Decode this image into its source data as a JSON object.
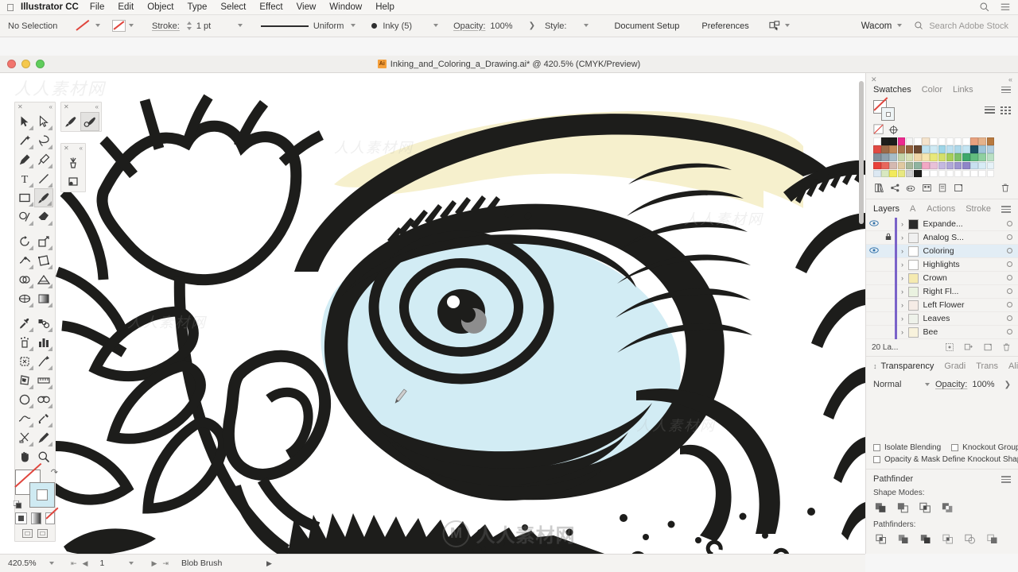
{
  "menubar": {
    "apple": "",
    "app_name": "Illustrator CC",
    "items": [
      "File",
      "Edit",
      "Object",
      "Type",
      "Select",
      "Effect",
      "View",
      "Window",
      "Help"
    ],
    "search_icon": "search-icon",
    "list_icon": "list-icon"
  },
  "optionsbar": {
    "selection_status": "No Selection",
    "stroke_label": "Stroke:",
    "stroke_weight": "1 pt",
    "profile_label": "Uniform",
    "brush_label": "Inky (5)",
    "opacity_label": "Opacity:",
    "opacity_value": "100%",
    "style_label": "Style:",
    "document_setup": "Document Setup",
    "preferences": "Preferences",
    "workspace_user": "Wacom",
    "search_placeholder": "Search Adobe Stock",
    "arrange_icon": "arrange-documents-icon"
  },
  "tabbar": {
    "doc_title": "Inking_and_Coloring_a_Drawing.ai* @ 420.5% (CMYK/Preview)",
    "badge": "Ai"
  },
  "toolbar": {
    "tools": [
      {
        "name": "selection-tool",
        "label": "Selection"
      },
      {
        "name": "direct-selection-tool",
        "label": "Direct Selection"
      },
      {
        "name": "magic-wand-tool",
        "label": "Magic Wand"
      },
      {
        "name": "lasso-tool",
        "label": "Lasso"
      },
      {
        "name": "pen-tool",
        "label": "Pen"
      },
      {
        "name": "curvature-tool",
        "label": "Curvature"
      },
      {
        "name": "type-tool",
        "label": "Type"
      },
      {
        "name": "line-segment-tool",
        "label": "Line Segment"
      },
      {
        "name": "rectangle-tool",
        "label": "Rectangle"
      },
      {
        "name": "paintbrush-tool",
        "label": "Paintbrush"
      },
      {
        "name": "shaper-tool",
        "label": "Shaper"
      },
      {
        "name": "eraser-tool",
        "label": "Eraser"
      },
      {
        "name": "rotate-tool",
        "label": "Rotate"
      },
      {
        "name": "scale-tool",
        "label": "Scale"
      },
      {
        "name": "width-tool",
        "label": "Width"
      },
      {
        "name": "free-transform-tool",
        "label": "Free Transform"
      },
      {
        "name": "shape-builder-tool",
        "label": "Shape Builder"
      },
      {
        "name": "perspective-grid-tool",
        "label": "Perspective Grid"
      },
      {
        "name": "mesh-tool",
        "label": "Mesh"
      },
      {
        "name": "gradient-tool",
        "label": "Gradient"
      },
      {
        "name": "eyedropper-tool",
        "label": "Eyedropper"
      },
      {
        "name": "blend-tool",
        "label": "Blend"
      },
      {
        "name": "symbol-sprayer-tool",
        "label": "Symbol Sprayer"
      },
      {
        "name": "column-graph-tool",
        "label": "Column Graph"
      },
      {
        "name": "artboard-tool",
        "label": "Artboard"
      },
      {
        "name": "slice-tool",
        "label": "Slice"
      },
      {
        "name": "perspective-selection-tool",
        "label": "Perspective Selection"
      },
      {
        "name": "measure-tool",
        "label": "Measure"
      },
      {
        "name": "ellipse-tool",
        "label": "Ellipse"
      },
      {
        "name": "blob-brush-tool",
        "label": "Blob Brush"
      },
      {
        "name": "smooth-tool",
        "label": "Smooth"
      },
      {
        "name": "join-tool",
        "label": "Join"
      },
      {
        "name": "scissors-tool",
        "label": "Scissors"
      },
      {
        "name": "pencil-tool",
        "label": "Pencil"
      },
      {
        "name": "hand-tool",
        "label": "Hand"
      },
      {
        "name": "zoom-tool",
        "label": "Zoom"
      }
    ],
    "fill_stroke": {
      "fill_color": "#ffffff",
      "stroke_color": "#cfeaf2",
      "none_indicator": "#e0453d"
    },
    "float_brush": "paintbrush-tool",
    "float_blob": "blob-brush-tool",
    "float_symbol": "symbol-sprayer-tool",
    "float_slice": "slice-tool"
  },
  "swatches_panel": {
    "tabs": [
      "Swatches",
      "Color",
      "Links"
    ],
    "active_tab": "Swatches",
    "colors": [
      "#ffffff",
      "#1d1d1b",
      "#1d1d1b",
      "#ec2a8f",
      "#f5f5f5",
      "#ffffff",
      "#f4e3cc",
      "#ffffff",
      "#ffffff",
      "#ffffff",
      "#ffffff",
      "#ffffff",
      "#e8a17f",
      "#e5b28b",
      "#b8793f",
      "#e04a43",
      "#9c6b4a",
      "#c08858",
      "#a8754c",
      "#93613c",
      "#6d4a32",
      "#bfe2ef",
      "#cfe9f3",
      "#9fd6e8",
      "#bcdff0",
      "#aed8ea",
      "#c3e4f2",
      "#1b4f63",
      "#9ec4d8",
      "#b3cfe0",
      "#7f8f9b",
      "#8fa0ad",
      "#a7bdc8",
      "#c3d4a8",
      "#d8e0b4",
      "#f0d6a8",
      "#f5e6b0",
      "#e8e87a",
      "#d4e06a",
      "#a8cf5a",
      "#7ec16a",
      "#3fa86b",
      "#62bd7f",
      "#8fd0a0",
      "#b9e0c4",
      "#e8413a",
      "#e8665c",
      "#d4b8b0",
      "#e0c9a0",
      "#a8b89a",
      "#8fb4a0",
      "#f2a8c4",
      "#e8c0d8",
      "#c4b8e0",
      "#b0a8d8",
      "#9e96d0",
      "#8f86c8",
      "#c8e0f0",
      "#d8ecf6",
      "#e6f2f8",
      "#dce8f2",
      "#d8e8c0",
      "#f2ea5a",
      "#e8e880",
      "#d0d0d0",
      "#1d1d1b",
      "#ffffff",
      "#ffffff",
      "#ffffff",
      "#ffffff",
      "#ffffff",
      "#ffffff",
      "#ffffff",
      "#ffffff",
      "#ffffff"
    ],
    "footer_icons": [
      "swatch-libraries-icon",
      "show-swatch-kinds-icon",
      "color-group-icon",
      "new-color-group-icon",
      "swatch-options-icon",
      "new-swatch-icon",
      "delete-swatch-icon"
    ]
  },
  "layers_panel": {
    "tabs": [
      "Layers",
      "Appearan",
      "Actions",
      "Stroke"
    ],
    "active_tab": "Layers",
    "rows": [
      {
        "name": "Expande...",
        "visible": true,
        "locked": false,
        "selected": false,
        "thumb": "#2a2a2a"
      },
      {
        "name": "Analog S...",
        "visible": false,
        "locked": true,
        "selected": false,
        "thumb": "#f0f0f0"
      },
      {
        "name": "Coloring",
        "visible": true,
        "locked": false,
        "selected": true,
        "thumb": "#ffffff"
      },
      {
        "name": "Highlights",
        "visible": false,
        "locked": false,
        "selected": false,
        "thumb": "#ffffff"
      },
      {
        "name": "Crown",
        "visible": false,
        "locked": false,
        "selected": false,
        "thumb": "#f5eab0"
      },
      {
        "name": "Right Fl...",
        "visible": false,
        "locked": false,
        "selected": false,
        "thumb": "#eaf2e0"
      },
      {
        "name": "Left Flower",
        "visible": false,
        "locked": false,
        "selected": false,
        "thumb": "#f6ece6"
      },
      {
        "name": "Leaves",
        "visible": false,
        "locked": false,
        "selected": false,
        "thumb": "#eef2ea"
      },
      {
        "name": "Bee",
        "visible": false,
        "locked": false,
        "selected": false,
        "thumb": "#f8f2dc"
      }
    ],
    "count_label": "20 La...",
    "footer_icons": [
      "locate-object-icon",
      "make-sublayer-icon",
      "new-layer-icon",
      "delete-layer-icon"
    ]
  },
  "transparency_panel": {
    "tabs": [
      "Transparency",
      "Gradi",
      "Trans",
      "Align"
    ],
    "active_tab": "Transparency",
    "blend_mode": "Normal",
    "opacity_label": "Opacity:",
    "opacity_value": "100%",
    "checkboxes": [
      {
        "label": "Isolate Blending",
        "checked": false
      },
      {
        "label": "Knockout Group",
        "checked": false
      },
      {
        "label": "Opacity & Mask Define Knockout Shape",
        "checked": false
      }
    ]
  },
  "pathfinder_panel": {
    "title": "Pathfinder",
    "shape_modes_label": "Shape Modes:",
    "shape_modes": [
      "unite-icon",
      "minus-front-icon",
      "intersect-icon",
      "exclude-icon"
    ],
    "pathfinders_label": "Pathfinders:",
    "pathfinders": [
      "divide-icon",
      "trim-icon",
      "merge-icon",
      "crop-icon",
      "outline-icon",
      "minus-back-icon"
    ]
  },
  "statusbar": {
    "zoom": "420.5%",
    "page": "1",
    "tool": "Blob Brush"
  },
  "watermarks": {
    "circle_glyph": "M",
    "text": "人人素材网",
    "corner_text": "人人素材网"
  }
}
